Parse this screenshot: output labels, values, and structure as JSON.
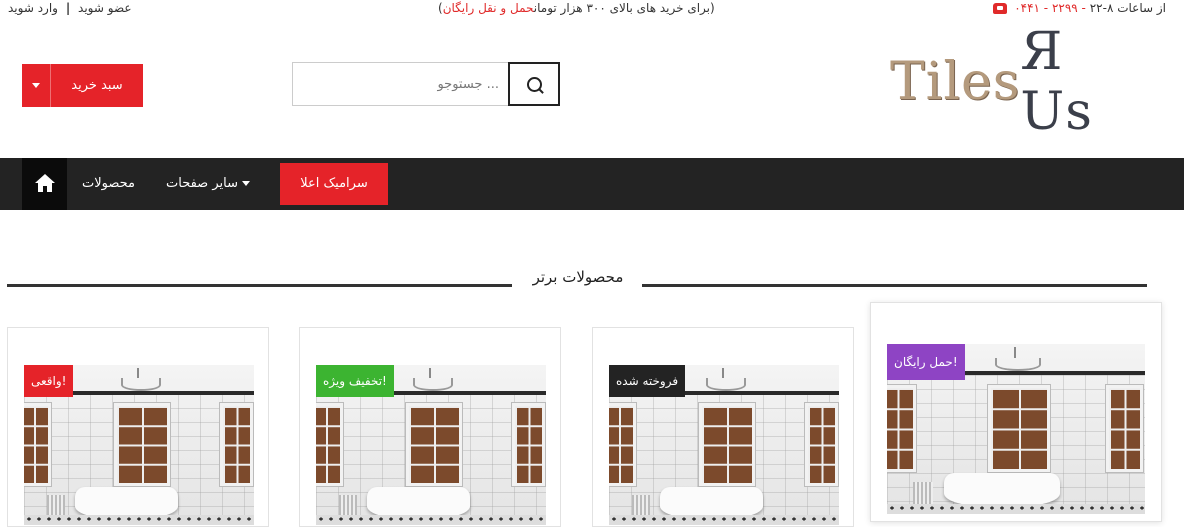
{
  "topbar": {
    "signup": "عضو شوید",
    "login": "وارد شوید",
    "separator": "|",
    "promo_highlight": "حمل و نقل رایگان",
    "promo_rest": "(برای خرید های بالای ۳۰۰ هزار تومان",
    "promo_tail": ")",
    "hours_label": "از ساعات ۸-۲۲",
    "phone": "- ۲۲۹۹ - ۰۴۴۱"
  },
  "header": {
    "cart_label": "سبد خرید",
    "search_placeholder": "... جستوجو",
    "logo_part1": "Til",
    "logo_part2": "es",
    "logo_part3": " Я Us"
  },
  "nav": {
    "products": "محصولات",
    "other_pages": "سایر صفحات",
    "ceramic": "سرامیک اعلا"
  },
  "section": {
    "title": "محصولات برتر"
  },
  "products": [
    {
      "badge": "!واقعی",
      "badge_color": "#e52329"
    },
    {
      "badge": "!تخفیف ویژه",
      "badge_color": "#3cb431"
    },
    {
      "badge": "فروخته شده",
      "badge_color": "#232323"
    },
    {
      "badge": "!حمل رایگان",
      "badge_color": "#8e44c4"
    }
  ],
  "colors": {
    "accent_red": "#e52329",
    "nav_bg": "#232323"
  }
}
